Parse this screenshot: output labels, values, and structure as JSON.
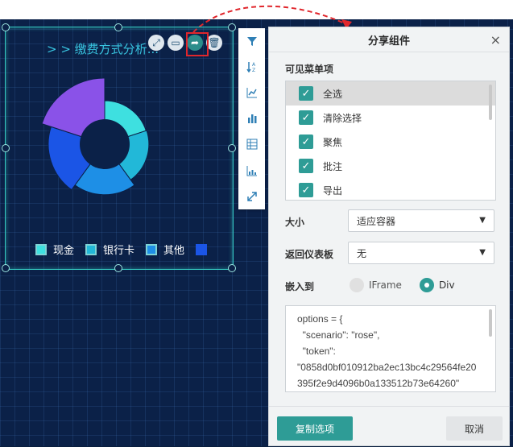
{
  "widget": {
    "title": "> > 缴费方式分析",
    "title_overflow": "...",
    "actions": [
      "expand-icon",
      "comment-icon",
      "share-icon",
      "delete-icon"
    ]
  },
  "legend": [
    {
      "label": "现金",
      "color": "#3ee0e0"
    },
    {
      "label": "银行卡",
      "color": "#22b8d8"
    },
    {
      "label": "其他",
      "color": "#1e8fe6"
    },
    {
      "label": "",
      "color": "#1b55e6"
    }
  ],
  "chart_data": {
    "type": "pie",
    "variant": "rose",
    "categories": [
      "现金",
      "银行卡",
      "其他",
      "",
      ""
    ],
    "values": [
      60,
      62,
      82,
      100,
      130
    ],
    "colors": [
      "#3ee0e0",
      "#22b8d8",
      "#1e8fe6",
      "#1b55e6",
      "#8a52e8"
    ],
    "note_inner_radius": 32
  },
  "toolbar": [
    "filter-icon",
    "sort-icon",
    "line-chart-icon",
    "bar-chart-icon",
    "table-icon",
    "stacked-chart-icon",
    "expand-icon"
  ],
  "dialog": {
    "title": "分享组件",
    "close": "×",
    "visible_menu_label": "可见菜单项",
    "menu_items": [
      "全选",
      "清除选择",
      "聚焦",
      "批注",
      "导出"
    ],
    "size_label": "大小",
    "size_value": "适应容器",
    "back_label": "返回仪表板",
    "back_value": "无",
    "embed_label": "嵌入到",
    "embed_options": [
      "IFrame",
      "Div"
    ],
    "embed_selected": "Div",
    "code_lines": [
      "options = {",
      "  \"scenario\": \"rose\",",
      "  \"token\":",
      "\"0858d0bf010912ba2ec13bc4c29564fe20395f2e9d4096b0a133512b73e64260\""
    ],
    "copy_button": "复制选项",
    "cancel_button": "取消"
  },
  "colors": {
    "accent": "#2e9c96",
    "background": "#0b2148",
    "highlight": "#e0262c"
  }
}
